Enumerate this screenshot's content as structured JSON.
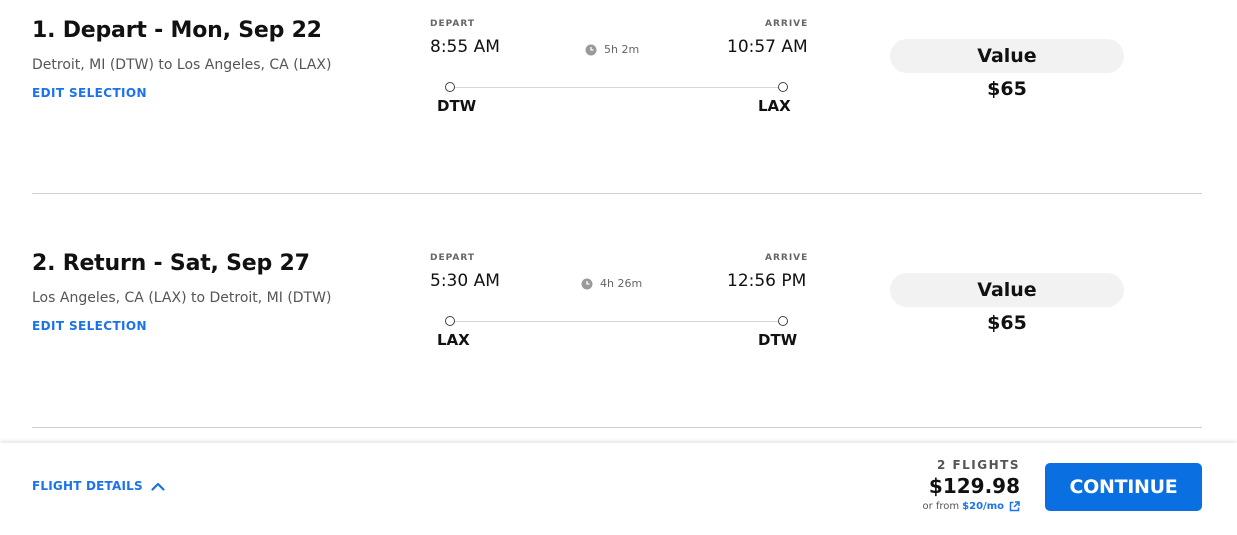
{
  "segments": [
    {
      "title": "1. Depart - Mon, Sep 22",
      "route": "Detroit, MI (DTW) to Los Angeles, CA (LAX)",
      "edit_label": "EDIT SELECTION",
      "depart_label": "DEPART",
      "arrive_label": "ARRIVE",
      "depart_time": "8:55 AM",
      "arrive_time": "10:57 AM",
      "duration": "5h 2m",
      "origin": "DTW",
      "destination": "LAX",
      "fare_type": "Value",
      "fare_price": "$65"
    },
    {
      "title": "2. Return - Sat, Sep 27",
      "route": "Los Angeles, CA (LAX) to Detroit, MI (DTW)",
      "edit_label": "EDIT SELECTION",
      "depart_label": "DEPART",
      "arrive_label": "ARRIVE",
      "depart_time": "5:30 AM",
      "arrive_time": "12:56 PM",
      "duration": "4h 26m",
      "origin": "LAX",
      "destination": "DTW",
      "fare_type": "Value",
      "fare_price": "$65"
    }
  ],
  "footer": {
    "flight_details_label": "FLIGHT DETAILS",
    "flights_count": "2 FLIGHTS",
    "total_price": "$129.98",
    "financing_prefix": "or from",
    "financing_amount": "$20/mo",
    "continue_label": "CONTINUE"
  },
  "colors": {
    "accent": "#1a73e8",
    "button": "#0a6fe0",
    "pill_bg": "#f2f2f2",
    "divider": "#cfcfcf"
  },
  "icons": [
    "clock-icon",
    "chevron-up-icon",
    "external-link-icon"
  ]
}
